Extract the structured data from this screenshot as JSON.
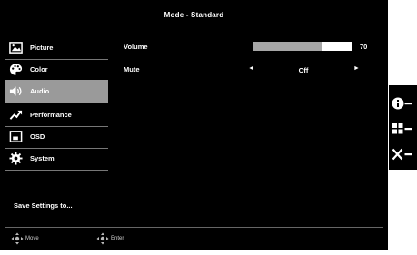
{
  "header": {
    "title": "Mode - Standard"
  },
  "sidebar": {
    "items": [
      {
        "label": "Picture",
        "icon": "picture-icon",
        "active": false
      },
      {
        "label": "Color",
        "icon": "palette-icon",
        "active": false
      },
      {
        "label": "Audio",
        "icon": "speaker-icon",
        "active": true
      },
      {
        "label": "Performance",
        "icon": "performance-arrow-icon",
        "active": false
      },
      {
        "label": "OSD",
        "icon": "osd-window-icon",
        "active": false
      },
      {
        "label": "System",
        "icon": "gear-icon",
        "active": false
      }
    ]
  },
  "content": {
    "volume": {
      "label": "Volume",
      "value": "70",
      "level_percent": 70
    },
    "mute": {
      "label": "Mute",
      "value": "Off",
      "left_arrow": "◄",
      "right_arrow": "►"
    }
  },
  "footer": {
    "save_label": "Save Settings to...",
    "move_hint": "Move",
    "enter_hint": "Enter"
  },
  "keys": {
    "info_icon": "info-icon",
    "menu_icon": "grid-menu-icon",
    "close_icon": "close-icon"
  },
  "colors": {
    "osd_background": "#000000",
    "active_item": "#9a9a9a",
    "volume_fill": "#a6a6a6",
    "volume_track": "#ffffff"
  }
}
